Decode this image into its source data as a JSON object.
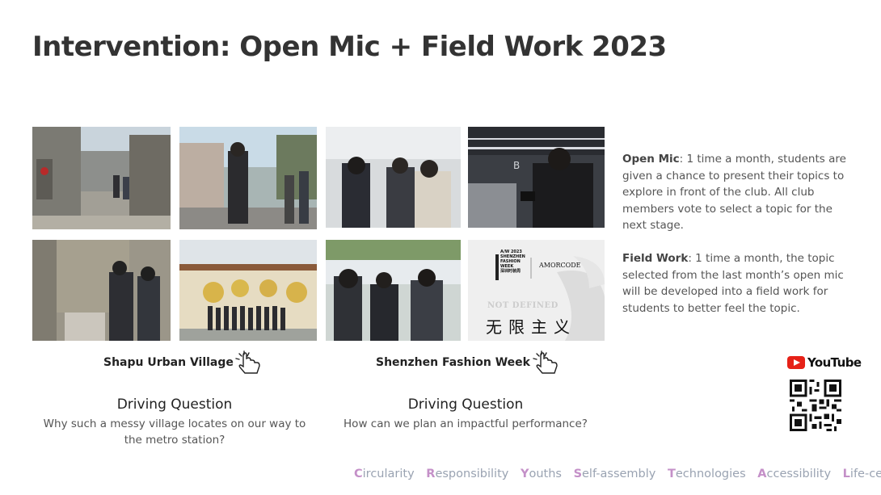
{
  "title": "Intervention: Open Mic + Field Work 2023",
  "groups": [
    {
      "caption": "Shapu Urban Village",
      "dq_title": "Driving Question",
      "dq_text": "Why such a messy village locates on our way to the metro station?"
    },
    {
      "caption": "Shenzhen Fashion Week",
      "dq_title": "Driving Question",
      "dq_text": "How can we plan an impactful performance?"
    }
  ],
  "description": {
    "open_mic_label": "Open Mic",
    "open_mic_text": ": 1 time a month, students are given a chance to present their topics to explore in front of the club. All club members vote to select a topic for the next stage.",
    "field_work_label": "Field Work",
    "field_work_text": ": 1 time a month, the topic selected from the last month’s open mic will be developed into a field work for students to better feel the topic."
  },
  "poster": {
    "logo_line1": "A/W 2023",
    "logo_line2": "SHENZHEN",
    "logo_line3": "FASHION",
    "logo_line4": "WEEK",
    "logo_cn": "深圳时装周",
    "brand": "AMORCODE",
    "tag": "NOT DEFINED",
    "cn": "无限主义"
  },
  "youtube": "YouTube",
  "footer": [
    {
      "initial": "C",
      "rest": "ircularity",
      "color": "#c490c8"
    },
    {
      "initial": "R",
      "rest": "esponsibility",
      "color": "#c490c8"
    },
    {
      "initial": "Y",
      "rest": "ouths",
      "color": "#c490c8"
    },
    {
      "initial": "S",
      "rest": "elf-assembly",
      "color": "#c490c8"
    },
    {
      "initial": "T",
      "rest": "echnologies",
      "color": "#c490c8"
    },
    {
      "initial": "A",
      "rest": "ccessibility",
      "color": "#c490c8"
    },
    {
      "initial": "L",
      "rest": "ife-centrism",
      "color": "#c490c8"
    }
  ],
  "colors": {
    "accent": "#c490c8",
    "footer_text": "#9aa3b2",
    "youtube_red": "#e62117"
  }
}
